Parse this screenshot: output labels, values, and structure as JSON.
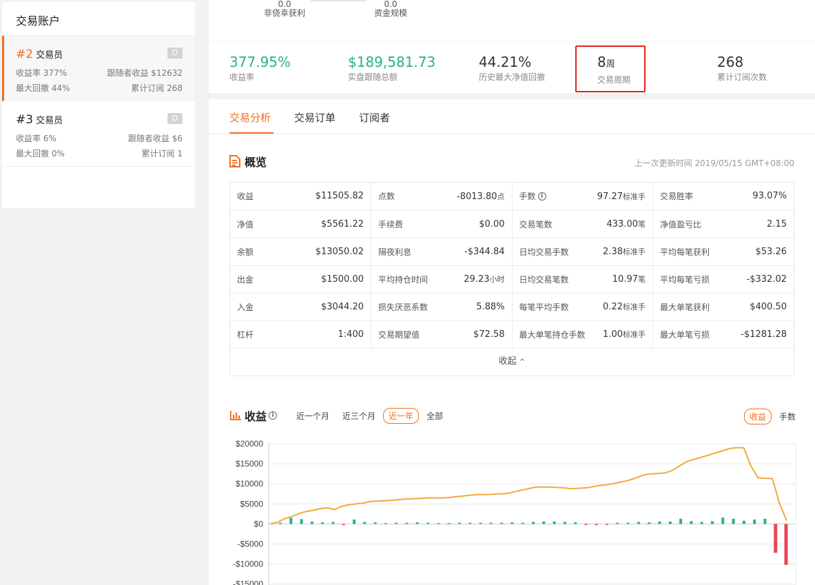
{
  "sidebar": {
    "title": "交易账户",
    "accounts": [
      {
        "rank": "#2",
        "name": "交易员",
        "badge": "D",
        "return_label": "收益率",
        "return_value": "377%",
        "follower_label": "跟随者收益",
        "follower_value": "$12632",
        "drawdown_label": "最大回撤",
        "drawdown_value": "44%",
        "subs_label": "累计订阅",
        "subs_value": "268"
      },
      {
        "rank": "#3",
        "name": "交易员",
        "badge": "D",
        "return_label": "收益率",
        "return_value": "6%",
        "follower_label": "跟随者收益",
        "follower_value": "$6",
        "drawdown_label": "最大回撤",
        "drawdown_value": "0%",
        "subs_label": "累计订阅",
        "subs_value": "1"
      }
    ]
  },
  "top_strip": {
    "item1_value": "0.0",
    "item1_label": "非侥幸获利",
    "item2_value": "0.0",
    "item2_label": "资金规模"
  },
  "stats": {
    "return_rate": {
      "value": "377.95%",
      "label": "收益率"
    },
    "follow_total": {
      "value": "$189,581.73",
      "label": "实盘跟随总额"
    },
    "max_drawdown": {
      "value": "44.21%",
      "label": "历史最大净值回撤"
    },
    "trade_period": {
      "value": "8",
      "unit": "周",
      "label": "交易周期"
    },
    "subscriptions": {
      "value": "268",
      "label": "累计订阅次数"
    }
  },
  "tabs": [
    "交易分析",
    "交易订单",
    "订阅者"
  ],
  "overview": {
    "title": "概览",
    "update_time": "上一次更新时间 2019/05/15 GMT+08:00",
    "rows": [
      [
        {
          "k": "收益",
          "v": "$11505.82"
        },
        {
          "k": "点数",
          "v": "-8013.80",
          "u": "点"
        },
        {
          "k": "手数",
          "v": "97.27",
          "u": "标准手",
          "info": "i"
        },
        {
          "k": "交易胜率",
          "v": "93.07%"
        }
      ],
      [
        {
          "k": "净值",
          "v": "$5561.22"
        },
        {
          "k": "手续费",
          "v": "$0.00"
        },
        {
          "k": "交易笔数",
          "v": "433.00",
          "u": "笔"
        },
        {
          "k": "净值盈亏比",
          "v": "2.15"
        }
      ],
      [
        {
          "k": "余额",
          "v": "$13050.02"
        },
        {
          "k": "隔夜利息",
          "v": "-$344.84"
        },
        {
          "k": "日均交易手数",
          "v": "2.38",
          "u": "标准手"
        },
        {
          "k": "平均每笔获利",
          "v": "$53.26"
        }
      ],
      [
        {
          "k": "出金",
          "v": "$1500.00"
        },
        {
          "k": "平均持仓时间",
          "v": "29.23",
          "u": "小时"
        },
        {
          "k": "日均交易笔数",
          "v": "10.97",
          "u": "笔"
        },
        {
          "k": "平均每笔亏损",
          "v": "-$332.02"
        }
      ],
      [
        {
          "k": "入金",
          "v": "$3044.20"
        },
        {
          "k": "损失厌恶系数",
          "v": "5.88%"
        },
        {
          "k": "每笔平均手数",
          "v": "0.22",
          "u": "标准手"
        },
        {
          "k": "最大单笔获利",
          "v": "$400.50"
        }
      ],
      [
        {
          "k": "杠杆",
          "v": "1:400"
        },
        {
          "k": "交易期望值",
          "v": "$72.58"
        },
        {
          "k": "最大单笔持仓手数",
          "v": "1.00",
          "u": "标准手"
        },
        {
          "k": "最大单笔亏损",
          "v": "-$1281.28"
        }
      ]
    ],
    "collapse_label": "收起"
  },
  "profit_chart": {
    "title": "收益",
    "info": "i",
    "ranges": [
      "近一个月",
      "近三个月",
      "近一年",
      "全部"
    ],
    "active_range": 2,
    "metrics": [
      "收益",
      "手数"
    ],
    "active_metric": 0
  },
  "colors": {
    "accent": "#f06d1f",
    "green": "#23b28c",
    "line": "#f2a93b",
    "red": "#e5485b",
    "highlight": "#e0211d"
  },
  "chart_data": {
    "type": "bar",
    "ylim": [
      -15000,
      20000
    ],
    "yticks": [
      "$20000",
      "$15000",
      "$10000",
      "$5000",
      "$0",
      "-$5000",
      "-$10000",
      "-$15000"
    ],
    "ytick_values": [
      20000,
      15000,
      10000,
      5000,
      0,
      -5000,
      -10000,
      -15000
    ],
    "series": [
      {
        "type": "line",
        "values": [
          0,
          400,
          1300,
          1800,
          2600,
          3100,
          3400,
          3800,
          4000,
          3600,
          4400,
          4800,
          5000,
          5200,
          5600,
          5700,
          5800,
          5900,
          6100,
          6200,
          6300,
          6400,
          6500,
          6500,
          6500,
          6600,
          6800,
          7000,
          7200,
          7300,
          7300,
          7400,
          7500,
          7600,
          8000,
          8400,
          8800,
          9200,
          9200,
          9200,
          9100,
          9000,
          8800,
          8900,
          9000,
          9300,
          9600,
          9800,
          10100,
          10500,
          10900,
          11500,
          12200,
          12500,
          12600,
          12700,
          13300,
          14400,
          15500,
          16100,
          16600,
          17100,
          17700,
          18200,
          18800,
          19000,
          19000,
          14500,
          11500,
          11400,
          11300,
          5000,
          800
        ]
      },
      {
        "type": "bar",
        "values": [
          300,
          1500,
          1200,
          600,
          400,
          500,
          -300,
          1100,
          500,
          400,
          200,
          300,
          300,
          400,
          300,
          200,
          200,
          300,
          300,
          300,
          300,
          300,
          400,
          300,
          500,
          600,
          600,
          500,
          400,
          -200,
          -300,
          -200,
          300,
          300,
          500,
          400,
          600,
          600,
          1300,
          700,
          500,
          700,
          1600,
          1300,
          800,
          1100,
          1300,
          -7200,
          -10200
        ]
      }
    ]
  }
}
